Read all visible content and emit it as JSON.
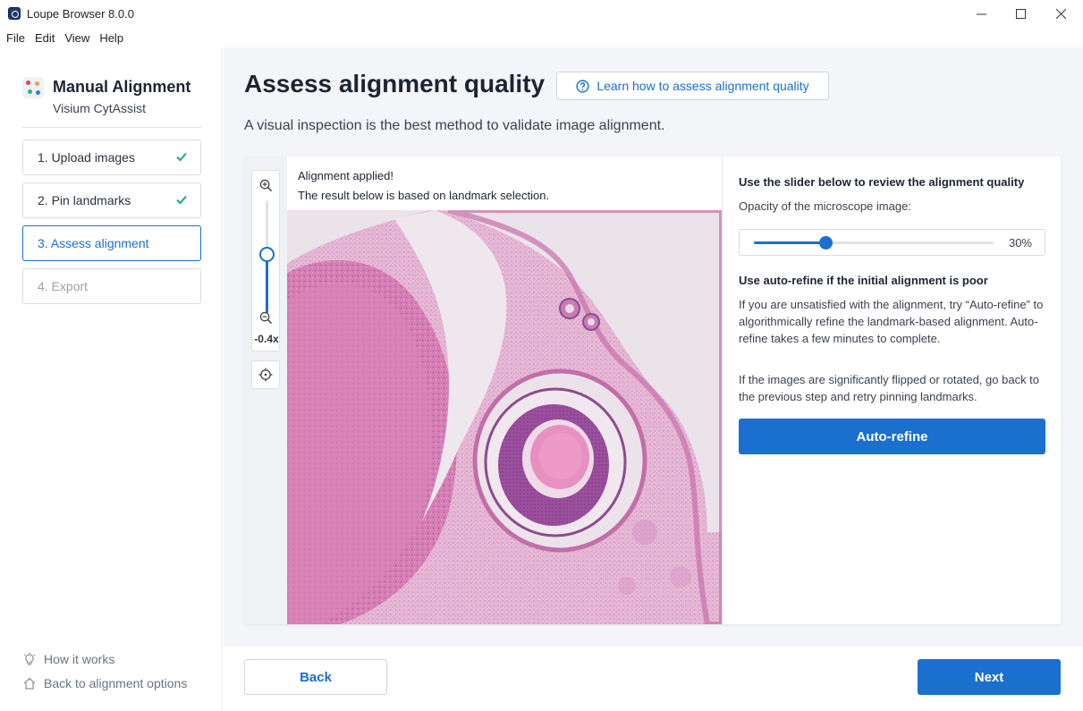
{
  "window": {
    "title": "Loupe Browser 8.0.0"
  },
  "menu": [
    "File",
    "Edit",
    "View",
    "Help"
  ],
  "sidebar": {
    "title": "Manual Alignment",
    "subtitle": "Visium CytAssist",
    "steps": [
      {
        "label": "1. Upload images",
        "status": "complete"
      },
      {
        "label": "2. Pin landmarks",
        "status": "complete"
      },
      {
        "label": "3. Assess alignment",
        "status": "active"
      },
      {
        "label": "4. Export",
        "status": "disabled"
      }
    ],
    "how_it_works": "How it works",
    "back_to_options": "Back to alignment options"
  },
  "main": {
    "title": "Assess alignment quality",
    "learn_link": "Learn how to assess alignment quality",
    "description": "A visual inspection is the best method to validate image alignment."
  },
  "viewer": {
    "zoom_label": "-0.4x",
    "zoom_level": 0.65,
    "message_line1": "Alignment applied!",
    "message_line2": "The result below is based on landmark selection."
  },
  "panel": {
    "slider_heading": "Use the slider below to review the alignment quality",
    "opacity_label": "Opacity of the microscope image:",
    "opacity_value": 30,
    "opacity_text": "30%",
    "autorefine_heading": "Use auto-refine if the initial alignment is poor",
    "autorefine_text1": "If you are unsatisfied with the alignment, try “Auto-refine” to algorithmically refine the landmark-based alignment. Auto-refine takes a few minutes to complete.",
    "autorefine_text2": "If the images are significantly flipped or rotated, go back to the previous step and retry pinning landmarks.",
    "autorefine_button": "Auto-refine"
  },
  "footer": {
    "back": "Back",
    "next": "Next"
  },
  "colors": {
    "accent": "#1a6fcf",
    "check": "#1aa88c",
    "tissue": "#c96aa6"
  }
}
